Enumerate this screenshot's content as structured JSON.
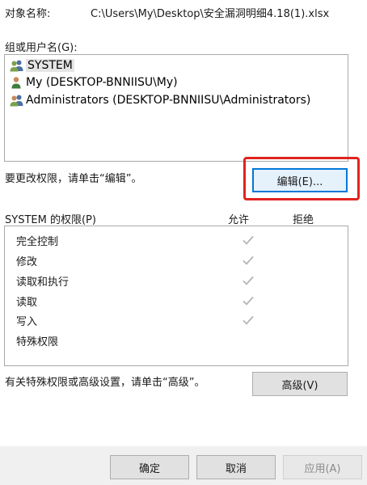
{
  "object": {
    "label": "对象名称:",
    "value": "C:\\Users\\My\\Desktop\\安全漏洞明细4.18(1).xlsx"
  },
  "groups": {
    "label": "组或用户名(G):",
    "items": [
      {
        "name": "SYSTEM",
        "icon": "users-group-icon",
        "selected": true
      },
      {
        "name": "My (DESKTOP-BNNIISU\\My)",
        "icon": "user-icon",
        "selected": false
      },
      {
        "name": "Administrators (DESKTOP-BNNIISU\\Administrators)",
        "icon": "users-group-icon",
        "selected": false
      }
    ]
  },
  "change_hint": "要更改权限，请单击“编辑”。",
  "edit_button": "编辑(E)...",
  "permissions": {
    "label": "SYSTEM 的权限(P)",
    "allow_header": "允许",
    "deny_header": "拒绝",
    "rows": [
      {
        "name": "完全控制",
        "allow": true,
        "deny": false
      },
      {
        "name": "修改",
        "allow": true,
        "deny": false
      },
      {
        "name": "读取和执行",
        "allow": true,
        "deny": false
      },
      {
        "name": "读取",
        "allow": true,
        "deny": false
      },
      {
        "name": "写入",
        "allow": true,
        "deny": false
      },
      {
        "name": "特殊权限",
        "allow": false,
        "deny": false
      }
    ]
  },
  "advanced_hint": "有关特殊权限或高级设置，请单击“高级”。",
  "advanced_button": "高级(V)",
  "footer": {
    "ok": "确定",
    "cancel": "取消",
    "apply": "应用(A)"
  },
  "colors": {
    "highlight": "#e0231f",
    "check": "#b4b4b4",
    "focus_border": "#0078d7"
  }
}
